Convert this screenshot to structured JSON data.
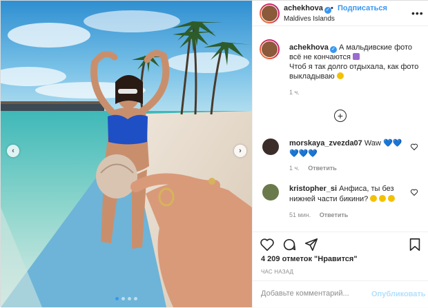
{
  "post": {
    "author": "achekhova",
    "location": "Maldives Islands",
    "follow_label": "Подписаться",
    "separator": "•"
  },
  "caption": {
    "username": "achekhova",
    "line1": "А мальдивские фото",
    "line2": "всё не кончаются",
    "line3": "Чтоб я так долго отдыхала, как фото",
    "line4": "выкладываю",
    "time": "1 ч."
  },
  "comments": [
    {
      "username": "morskaya_zvezda07",
      "text": "Waw",
      "hearts_inline": "💙💙",
      "hearts_line2": "💙💙💙",
      "time": "1 ч.",
      "reply_label": "Ответить"
    },
    {
      "username": "kristopher_si",
      "text": "Анфиса, ты без",
      "text2": "нижней части бикини?",
      "time": "51 мин.",
      "reply_label": "Ответить"
    }
  ],
  "likes": "4 209 отметок \"Нравится\"",
  "posted_ago": "ЧАС НАЗАД",
  "add_comment": {
    "placeholder": "Добавьте комментарий...",
    "publish_label": "Опубликовать"
  },
  "icons": {
    "more": "more-horizontal-icon",
    "like": "heart-icon",
    "comment": "comment-icon",
    "share": "share-icon",
    "save": "bookmark-icon",
    "add": "plus-circle-icon"
  },
  "colors": {
    "accent": "#3897f0",
    "text": "#262626",
    "muted": "#8e8e8e",
    "publish_disabled": "#b2dffc"
  },
  "carousel": {
    "slides": 4,
    "active_index": 0
  }
}
